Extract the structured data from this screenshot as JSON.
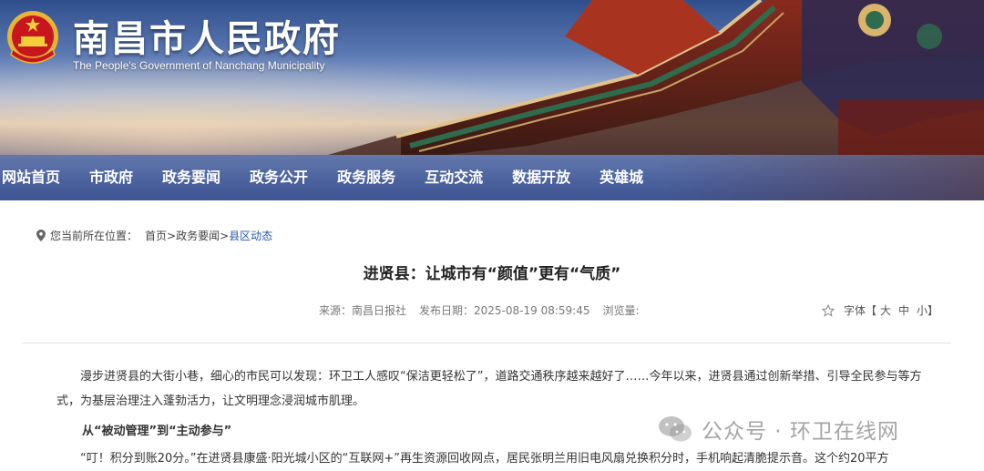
{
  "header": {
    "title": "南昌市人民政府",
    "subtitle": "The People's Government of Nanchang Municipality"
  },
  "nav": {
    "items": [
      "网站首页",
      "市政府",
      "政务要闻",
      "政务公开",
      "政务服务",
      "互动交流",
      "数据开放",
      "英雄城"
    ]
  },
  "breadcrumb": {
    "prefix": "您当前所在位置：",
    "home": "首页",
    "sep": ">",
    "section": "政务要闻",
    "current": "县区动态"
  },
  "article": {
    "title": "进贤县：让城市有“颜值”更有“气质”",
    "source": "来源：南昌日报社",
    "date": "发布日期：2025-08-19 08:59:45",
    "views": "浏览量:",
    "font_label": "字体【",
    "font_large": "大",
    "font_medium": "中",
    "font_small": "小】",
    "para1": "漫步进贤县的大街小巷，细心的市民可以发现：环卫工人感叹“保洁更轻松了”，道路交通秩序越来越好了……今年以来，进贤县通过创新举措、引导全民参与等方式，为基层治理注入蓬勃活力，让文明理念浸润城市肌理。",
    "subheading": "从“被动管理”到“主动参与”",
    "para2": "“叮！积分到账20分。”在进贤县康盛·阳光城小区的“互联网+”再生资源回收网点，居民张明兰用旧电风扇兑换积分时，手机响起清脆提示音。这个约20平方"
  },
  "watermark": {
    "text": "公众号 · 环卫在线网"
  },
  "colors": {
    "nav_bg": "#4d63a0",
    "breadcrumb_active": "#2a56a8"
  }
}
